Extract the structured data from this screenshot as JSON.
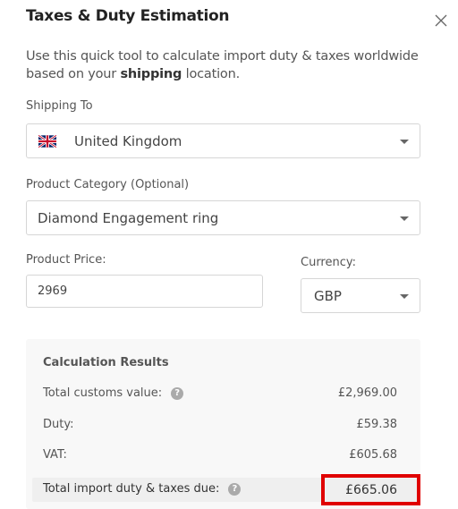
{
  "header": {
    "title": "Taxes & Duty Estimation",
    "close_icon": "close-icon"
  },
  "description": {
    "before": "Use this quick tool to calculate import duty & taxes worldwide based on your ",
    "bold": "shipping",
    "after": " location."
  },
  "shipping": {
    "label": "Shipping To",
    "value": "United Kingdom",
    "flag_icon": "uk-flag-icon"
  },
  "category": {
    "label": "Product Category (Optional)",
    "value": "Diamond Engagement ring"
  },
  "price": {
    "label": "Product Price:",
    "value": "2969"
  },
  "currency": {
    "label": "Currency:",
    "value": "GBP"
  },
  "results": {
    "heading": "Calculation Results",
    "rows": [
      {
        "label": "Total customs value:",
        "value": "£2,969.00",
        "help": true
      },
      {
        "label": "Duty:",
        "value": "£59.38"
      },
      {
        "label": "VAT:",
        "value": "£605.68"
      }
    ],
    "total": {
      "label": "Total import duty & taxes due:",
      "value": "£665.06"
    },
    "highlight_color": "#e00000"
  }
}
